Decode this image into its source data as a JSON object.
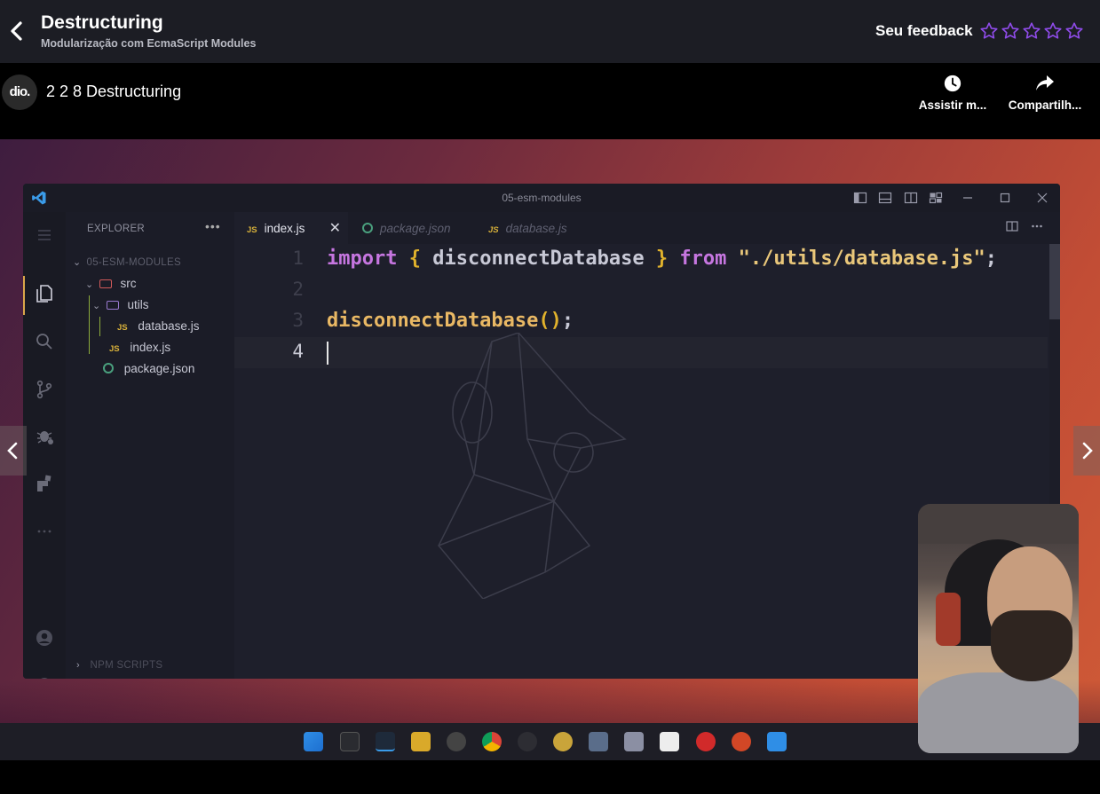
{
  "header": {
    "title": "Destructuring",
    "subtitle": "Modularização com EcmaScript Modules",
    "feedback_label": "Seu feedback",
    "rating_max": 5,
    "rating_value": 0,
    "star_color": "#8e4be8"
  },
  "video": {
    "channel_logo": "dio.",
    "title": "2 2 8 Destructuring",
    "watch_later_label": "Assistir m...",
    "share_label": "Compartilh..."
  },
  "vscode": {
    "window_title": "05-esm-modules",
    "explorer_label": "EXPLORER",
    "root_folder": "05-ESM-MODULES",
    "tree": [
      {
        "label": "src",
        "type": "folder"
      },
      {
        "label": "utils",
        "type": "folder"
      },
      {
        "label": "database.js",
        "type": "js"
      },
      {
        "label": "index.js",
        "type": "js"
      },
      {
        "label": "package.json",
        "type": "npm"
      }
    ],
    "tabs": [
      {
        "badge": "JS",
        "label": "index.js",
        "active": true
      },
      {
        "label": "package.json",
        "active": false
      },
      {
        "badge": "JS",
        "label": "database.js",
        "active": false
      }
    ],
    "line_numbers": [
      "1",
      "2",
      "3",
      "4"
    ],
    "code": {
      "line1": {
        "kw1": "import",
        "open": "{",
        "name": "disconnectDatabase",
        "close": "}",
        "kw2": "from",
        "path": "\"./utils/database.js\"",
        "semi": ";"
      },
      "line3": {
        "call": "disconnectDatabase",
        "parens": "()",
        "semi": ";"
      }
    },
    "npm_scripts_label": "NPM SCRIPTS",
    "js_badge": "JS",
    "close_symbol": "✕"
  },
  "icons": {
    "back": "chevron-left-icon",
    "star": "star-outline-icon",
    "clock": "clock-icon",
    "share": "share-arrow-icon",
    "prev": "chevron-left-icon",
    "next": "chevron-right-icon"
  }
}
